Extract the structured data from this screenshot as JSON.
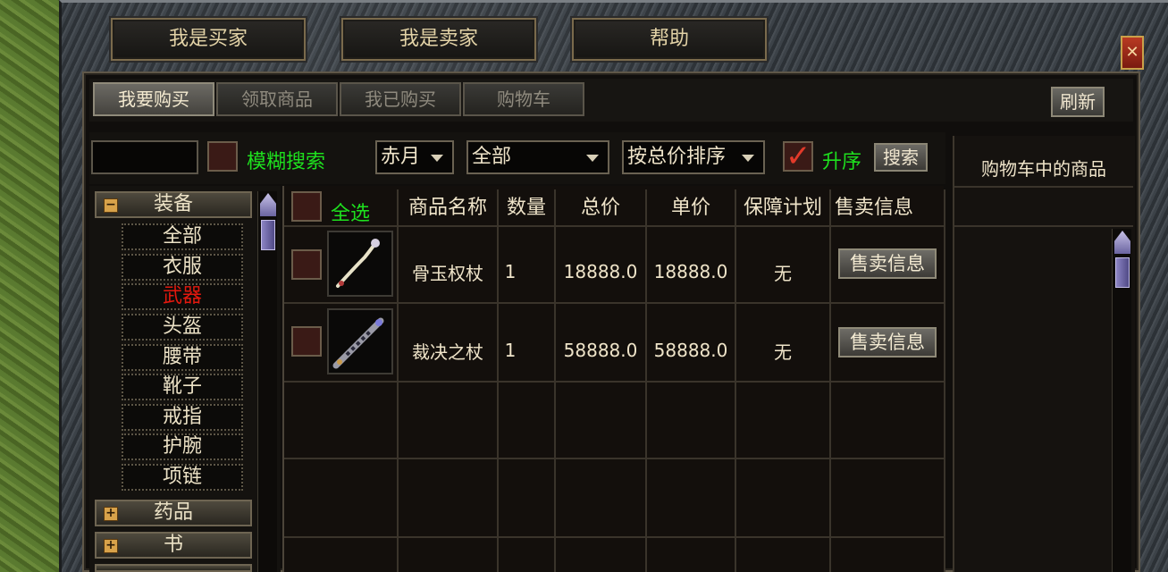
{
  "top_buttons": {
    "buyer": "我是买家",
    "seller": "我是卖家",
    "help": "帮助"
  },
  "close_symbol": "✕",
  "tabs": [
    {
      "label": "我要购买",
      "active": true
    },
    {
      "label": "领取商品",
      "active": false
    },
    {
      "label": "我已购买",
      "active": false
    },
    {
      "label": "购物车",
      "active": false
    }
  ],
  "refresh_label": "刷新",
  "search": {
    "input_value": "",
    "fuzzy_label": "模糊搜索",
    "server_select": "赤月",
    "type_select": "全部",
    "sort_select": "按总价排序",
    "ascending_label": "升序",
    "ascending_checked": true,
    "search_button": "搜索"
  },
  "categories": {
    "equipment": {
      "label": "装备",
      "expanded": true,
      "toggle": "−"
    },
    "sub_items": [
      {
        "label": "全部",
        "selected": false
      },
      {
        "label": "衣服",
        "selected": false
      },
      {
        "label": "武器",
        "selected": true
      },
      {
        "label": "头盔",
        "selected": false
      },
      {
        "label": "腰带",
        "selected": false
      },
      {
        "label": "靴子",
        "selected": false
      },
      {
        "label": "戒指",
        "selected": false
      },
      {
        "label": "护腕",
        "selected": false
      },
      {
        "label": "项链",
        "selected": false
      }
    ],
    "medicine": {
      "label": "药品",
      "toggle": "+"
    },
    "book": {
      "label": "书",
      "toggle": "+"
    }
  },
  "table": {
    "select_all": "全选",
    "headers": [
      "商品名称",
      "数量",
      "总价",
      "单价",
      "保障计划",
      "售卖信息"
    ],
    "rows": [
      {
        "name": "骨玉权杖",
        "qty": "1",
        "total": "18888.0",
        "unit": "18888.0",
        "guarantee": "无",
        "sell_info": "售卖信息",
        "icon": "bone-jade-scepter-icon"
      },
      {
        "name": "裁决之杖",
        "qty": "1",
        "total": "58888.0",
        "unit": "58888.0",
        "guarantee": "无",
        "sell_info": "售卖信息",
        "icon": "judgement-staff-icon"
      }
    ]
  },
  "cart": {
    "title": "购物车中的商品"
  },
  "colors": {
    "accent_green": "#1ee01e",
    "selected_red": "#e2180e",
    "text_cream": "#efe4c9",
    "check_red": "#e23a2a"
  }
}
